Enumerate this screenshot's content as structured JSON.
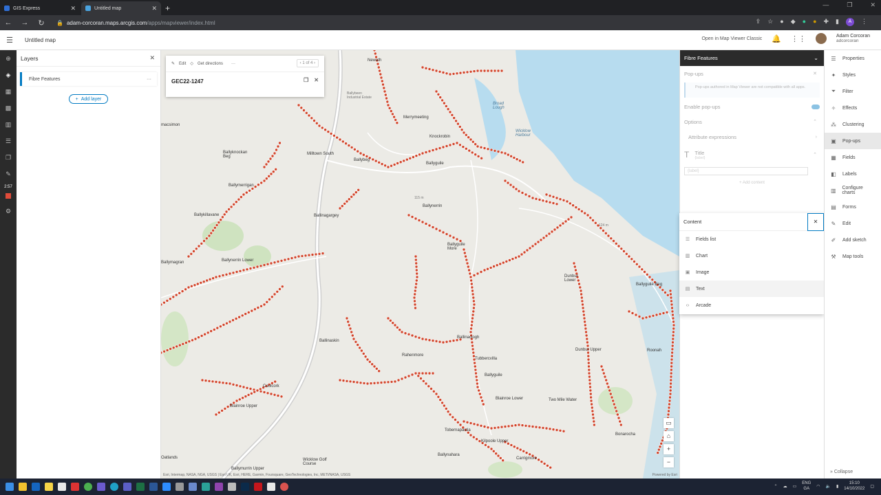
{
  "browser": {
    "tabs": [
      {
        "title": "GIS Express",
        "active": false,
        "favicon_color": "#2f6fd6"
      },
      {
        "title": "Untitled map",
        "active": true,
        "favicon_color": "#4aa3df"
      }
    ],
    "url_host": "adam-corcoran.maps.arcgis.com",
    "url_path": "/apps/mapviewer/index.html"
  },
  "header": {
    "map_title": "Untitled map",
    "classic_link": "Open in Map Viewer Classic",
    "user_name": "Adam Corcoran",
    "user_handle": "adcorcoran"
  },
  "leftbar": {
    "timer": "2:57"
  },
  "layers": {
    "title": "Layers",
    "items": [
      {
        "label": "Fibre Features"
      }
    ],
    "add_layer_label": "Add layer"
  },
  "popup": {
    "edit_label": "Edit",
    "directions_label": "Get directions",
    "pager": "1 of 4",
    "title": "GEC22-1247"
  },
  "map": {
    "attribution": "Esri, Intermap, NASA, NGA, USGS | Esri UK, Esri, HERE, Garmin, Foursquare, GeoTechnologies, Inc, METI/NASA, USGS",
    "powered_by": "Powered by Esri",
    "labels": [
      {
        "text": "Newath",
        "type": "place"
      },
      {
        "text": "Ballybeen Industrial Estate",
        "type": "small"
      },
      {
        "text": "Merrymeeting",
        "type": "place"
      },
      {
        "text": "Broad Lough",
        "type": "water"
      },
      {
        "text": "Wicklow Harbour",
        "type": "water"
      },
      {
        "text": "Knockrobin",
        "type": "place"
      },
      {
        "text": "Ballyknockan Beg",
        "type": "place"
      },
      {
        "text": "Milltown South",
        "type": "place"
      },
      {
        "text": "Ballybeg",
        "type": "place"
      },
      {
        "text": "Ballyguile",
        "type": "place"
      },
      {
        "text": "macsimon",
        "type": "place"
      },
      {
        "text": "Ballymerrigan",
        "type": "place"
      },
      {
        "text": "Ballynerrin",
        "type": "place"
      },
      {
        "text": "Ballykillavane",
        "type": "place"
      },
      {
        "text": "Ballinagargey",
        "type": "place"
      },
      {
        "text": "Ballymagran",
        "type": "place"
      },
      {
        "text": "Ballynerrin Lower",
        "type": "place"
      },
      {
        "text": "Ballyguile More",
        "type": "place"
      },
      {
        "text": "Dunbur Lower",
        "type": "place"
      },
      {
        "text": "Ballyguile Beg",
        "type": "place"
      },
      {
        "text": "Ballinaclogh",
        "type": "place"
      },
      {
        "text": "Ballinaskin",
        "type": "place"
      },
      {
        "text": "Rahenmore",
        "type": "place"
      },
      {
        "text": "Tubbercvilla",
        "type": "place"
      },
      {
        "text": "Ballyguile",
        "type": "place"
      },
      {
        "text": "Dunbur Upper",
        "type": "place"
      },
      {
        "text": "Roonah",
        "type": "place"
      },
      {
        "text": "Coolcork",
        "type": "place"
      },
      {
        "text": "Blainroe Upper",
        "type": "place"
      },
      {
        "text": "Blainroe Lower",
        "type": "place"
      },
      {
        "text": "Two Mile Water",
        "type": "place"
      },
      {
        "text": "Tobernapastia",
        "type": "place"
      },
      {
        "text": "Kilpoole Upper",
        "type": "place"
      },
      {
        "text": "Bonarocha",
        "type": "place"
      },
      {
        "text": "Ballynahara",
        "type": "place"
      },
      {
        "text": "Carrigmore",
        "type": "place"
      },
      {
        "text": "Oatlands",
        "type": "place"
      },
      {
        "text": "Ballymurrin Upper",
        "type": "place"
      },
      {
        "text": "Wicklow Golf Course",
        "type": "small"
      },
      {
        "text": "124 m",
        "type": "small"
      },
      {
        "text": "115 m",
        "type": "small"
      }
    ]
  },
  "properties": {
    "layer_title": "Fibre Features",
    "section": "Pop-ups",
    "info": "Pop-ups authored in Map Viewer are not compatible with all apps.",
    "enable_label": "Enable pop-ups",
    "options_label": "Options",
    "attr_expr_label": "Attribute expressions",
    "title_label": "Title",
    "title_sub": "{label}",
    "title_value": "{label}",
    "add_content": "Add content"
  },
  "content_menu": {
    "title": "Content",
    "items": [
      {
        "label": "Fields list",
        "icon": "list-icon"
      },
      {
        "label": "Chart",
        "icon": "chart-icon"
      },
      {
        "label": "Image",
        "icon": "image-icon"
      },
      {
        "label": "Text",
        "icon": "text-icon"
      },
      {
        "label": "Arcade",
        "icon": "code-icon"
      }
    ]
  },
  "right_toolbar": {
    "items": [
      {
        "label": "Properties",
        "icon": "properties-icon"
      },
      {
        "label": "Styles",
        "icon": "styles-icon"
      },
      {
        "label": "Filter",
        "icon": "filter-icon"
      },
      {
        "label": "Effects",
        "icon": "effects-icon"
      },
      {
        "label": "Clustering",
        "icon": "clustering-icon"
      },
      {
        "label": "Pop-ups",
        "icon": "popups-icon",
        "active": true
      },
      {
        "label": "Fields",
        "icon": "fields-icon"
      },
      {
        "label": "Labels",
        "icon": "labels-icon"
      },
      {
        "label": "Configure charts",
        "icon": "charts-icon"
      },
      {
        "label": "Forms",
        "icon": "forms-icon"
      },
      {
        "label": "Edit",
        "icon": "edit-icon"
      },
      {
        "label": "Add sketch",
        "icon": "sketch-icon"
      },
      {
        "label": "Map tools",
        "icon": "tools-icon"
      }
    ],
    "collapse_label": "Collapse"
  },
  "taskbar": {
    "lang": "ENG",
    "region": "GA",
    "time": "15:10",
    "date": "14/10/2022"
  },
  "colors": {
    "accent": "#007ac2",
    "feature_point": "#d2452b",
    "water": "#b7dcef",
    "terrain": "#ecebe6"
  }
}
